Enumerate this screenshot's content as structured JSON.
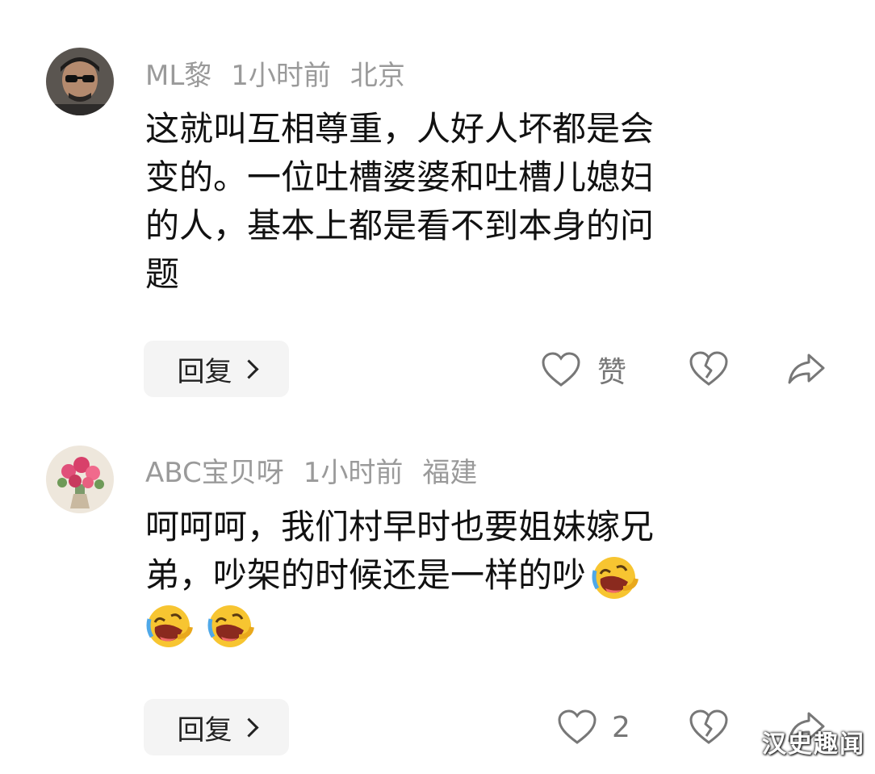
{
  "comments": [
    {
      "user": "ML黎",
      "time": "1小时前",
      "location": "北京",
      "lines": [
        "这就叫互相尊重，人好人坏都是会",
        "变的。一位吐槽婆婆和吐槽儿媳妇",
        "的人，基本上都是看不到本身的问",
        "题"
      ],
      "reply_label": "回复",
      "like_label": "赞"
    },
    {
      "user": "ABC宝贝呀",
      "time": "1小时前",
      "location": "福建",
      "lines": [
        "呵呵呵，我们村早时也要姐妹嫁兄",
        "弟，吵架的时候还是一样的吵"
      ],
      "reply_label": "回复",
      "like_count": "2"
    }
  ],
  "watermark": "汉史趣闻",
  "icons": [
    "heart-outline-icon",
    "broken-heart-icon",
    "share-icon",
    "laughing-emoji-icon",
    "chevron-right-icon"
  ]
}
